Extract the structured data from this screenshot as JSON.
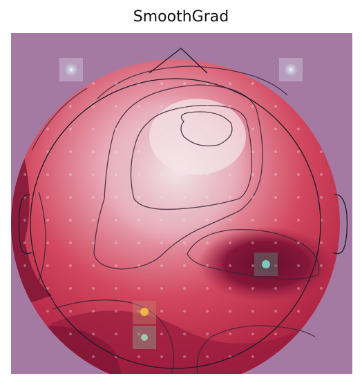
{
  "title": "SmoothGrad",
  "colors": {
    "background": "#a47aa2",
    "map_low": "#f2dde3",
    "map_mid": "#d43d57",
    "map_high": "#7a1032",
    "contour": "#3a2436",
    "head_outline": "#1c1c2a",
    "sensor_marker": "#e8eef0",
    "hot_spot": "#8ed0c0"
  },
  "map_type": "saliency topomap",
  "hot_spot_colors": [
    "#f2c040",
    "#80d8c8"
  ]
}
